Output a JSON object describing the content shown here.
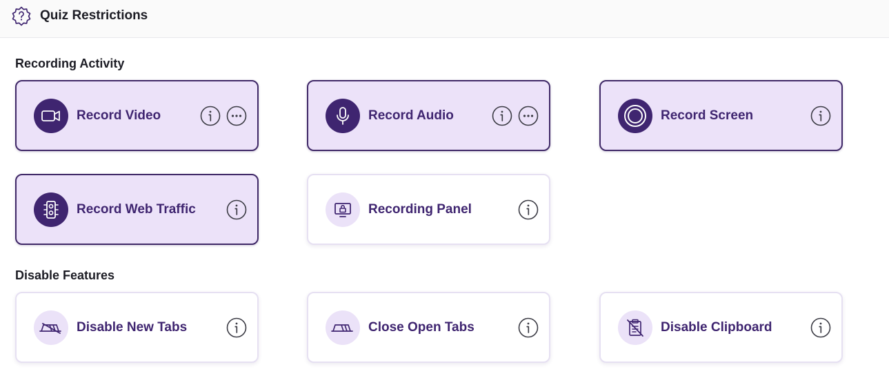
{
  "header": {
    "title": "Quiz Restrictions",
    "icon": "question-gear-icon"
  },
  "sections": {
    "recording": {
      "title": "Recording Activity",
      "cards": [
        {
          "label": "Record Video",
          "icon": "video-camera-icon",
          "active": true,
          "has_more": true
        },
        {
          "label": "Record Audio",
          "icon": "microphone-icon",
          "active": true,
          "has_more": true
        },
        {
          "label": "Record Screen",
          "icon": "screen-record-icon",
          "active": true,
          "has_more": false
        },
        {
          "label": "Record Web Traffic",
          "icon": "traffic-light-icon",
          "active": true,
          "has_more": false
        },
        {
          "label": "Recording Panel",
          "icon": "locked-monitor-icon",
          "active": false,
          "has_more": false
        }
      ]
    },
    "disable": {
      "title": "Disable Features",
      "cards": [
        {
          "label": "Disable New Tabs",
          "icon": "no-tabs-icon",
          "active": false,
          "has_more": false
        },
        {
          "label": "Close Open Tabs",
          "icon": "tabs-icon",
          "active": false,
          "has_more": false
        },
        {
          "label": "Disable Clipboard",
          "icon": "no-clipboard-icon",
          "active": false,
          "has_more": false
        }
      ]
    }
  },
  "colors": {
    "accent": "#3f2570",
    "active_bg": "#ece2f9",
    "inactive_circle": "#ebe2f8"
  }
}
